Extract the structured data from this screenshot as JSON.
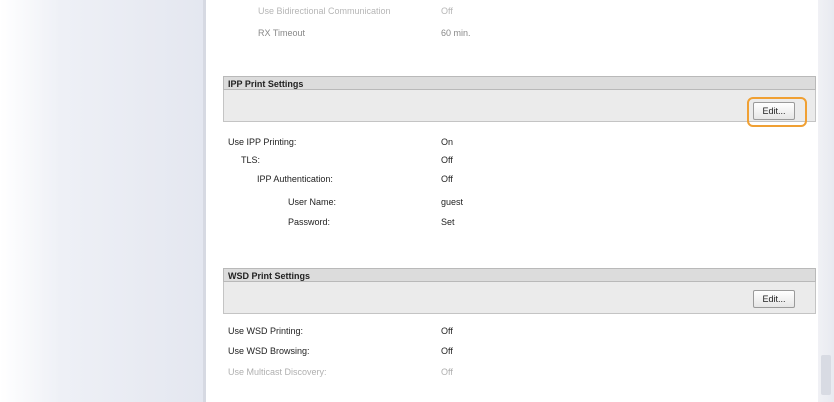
{
  "top_rows": [
    {
      "label": "Use Bidirectional Communication",
      "value": "Off"
    },
    {
      "label": "RX Timeout",
      "value": "60 min."
    }
  ],
  "ipp": {
    "title": "IPP Print Settings",
    "edit_label": "Edit...",
    "rows": [
      {
        "label": "Use IPP Printing:",
        "value": "On"
      },
      {
        "label": "TLS:",
        "value": "Off"
      },
      {
        "label": "IPP Authentication:",
        "value": "Off"
      },
      {
        "label": "User Name:",
        "value": "guest"
      },
      {
        "label": "Password:",
        "value": "Set"
      }
    ]
  },
  "wsd": {
    "title": "WSD Print Settings",
    "edit_label": "Edit...",
    "rows": [
      {
        "label": "Use WSD Printing:",
        "value": "Off"
      },
      {
        "label": "Use WSD Browsing:",
        "value": "Off"
      },
      {
        "label": "Use Multicast Discovery:",
        "value": "Off"
      }
    ]
  },
  "colors": {
    "highlight": "#f0a033",
    "header_bg": "#dcdcdc",
    "bar_bg": "#ebebeb"
  }
}
